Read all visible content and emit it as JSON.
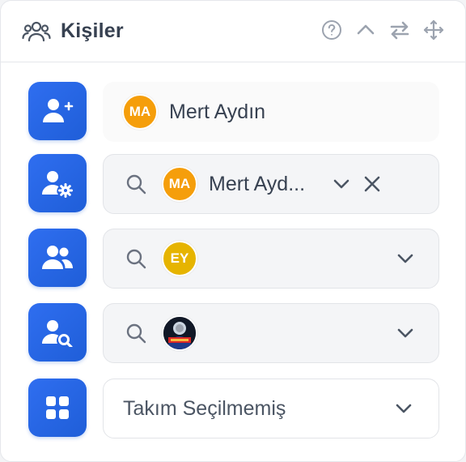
{
  "header": {
    "title": "Kişiler",
    "tools": [
      "help-icon",
      "collapse-icon",
      "swap-icon",
      "move-icon"
    ]
  },
  "rows": [
    {
      "button_icon": "user-add-icon",
      "avatar_initials": "MA",
      "avatar_color": "#f59e0b",
      "name": "Mert Aydın"
    },
    {
      "button_icon": "user-settings-icon",
      "avatar_initials": "MA",
      "avatar_color": "#f59e0b",
      "name": "Mert Ayd..."
    },
    {
      "button_icon": "users-icon",
      "avatar_initials": "EY",
      "avatar_color": "#e6b400"
    },
    {
      "button_icon": "user-search-icon",
      "avatar_icon": "avatar-photo"
    },
    {
      "button_icon": "grid-icon",
      "select_value": "Takım Seçilmemiş"
    }
  ],
  "colors": {
    "accent": "#2f6ef0",
    "text": "#374151",
    "border": "#e2e4e8"
  }
}
